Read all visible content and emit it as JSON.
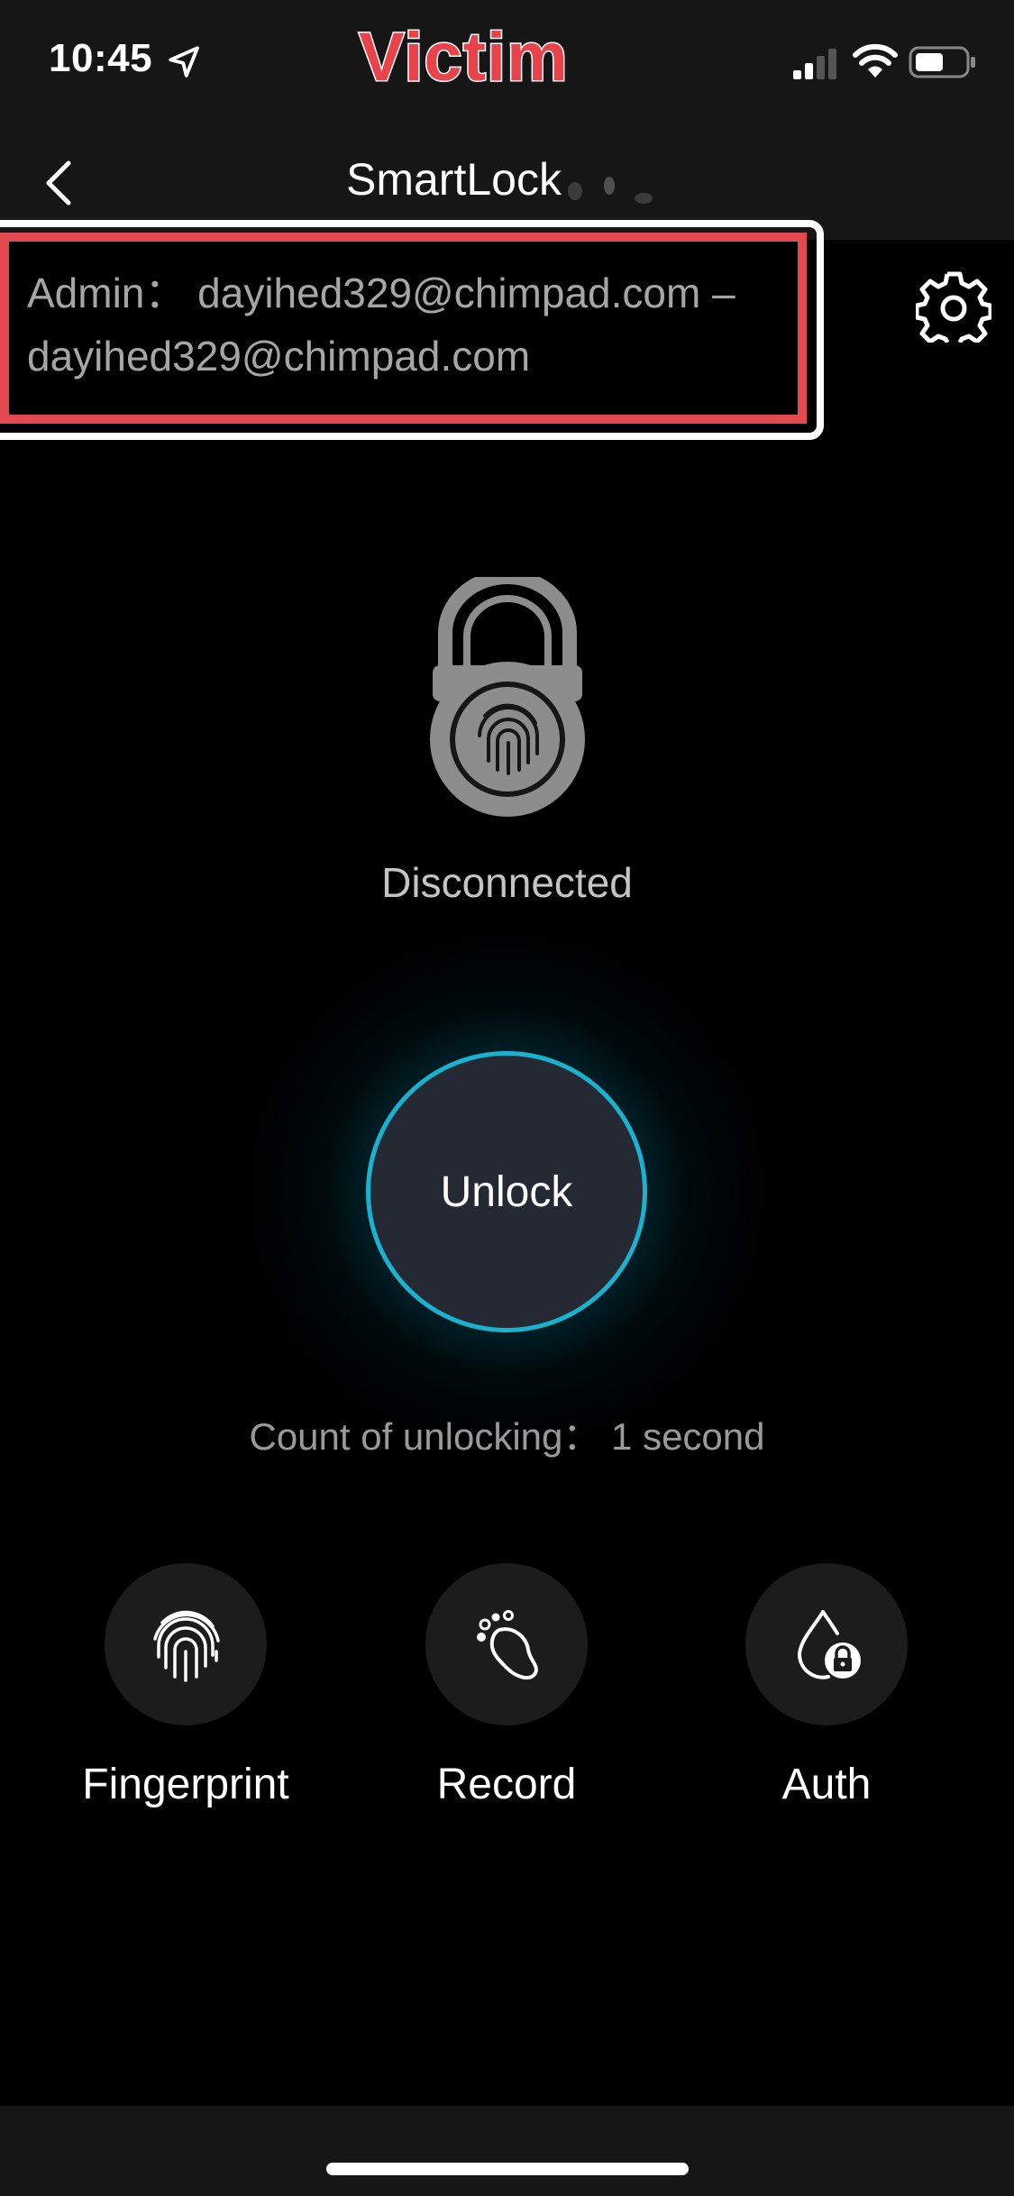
{
  "status_bar": {
    "time": "10:45",
    "watermark": "Victim",
    "icons": [
      "location-arrow-icon",
      "cellular-signal-icon",
      "wifi-icon",
      "battery-icon"
    ]
  },
  "nav": {
    "title": "SmartLock",
    "back_icon": "chevron-left-icon"
  },
  "admin": {
    "text": "Admin： dayihed329@chimpad.com – dayihed329@chimpad.com"
  },
  "settings_icon": "gear-icon",
  "lock": {
    "icon": "fingerprint-padlock-icon",
    "status": "Disconnected"
  },
  "unlock": {
    "label": "Unlock"
  },
  "count": {
    "text": "Count of unlocking： 1 second"
  },
  "actions": [
    {
      "label": "Fingerprint",
      "icon": "fingerprint-icon"
    },
    {
      "label": "Record",
      "icon": "footprint-icon"
    },
    {
      "label": "Auth",
      "icon": "auth-lock-icon"
    }
  ],
  "colors": {
    "accent": "#19b3d0",
    "highlight": "#e34a50",
    "watermark": "#e8424a",
    "background": "#000000",
    "bar": "#161616"
  }
}
